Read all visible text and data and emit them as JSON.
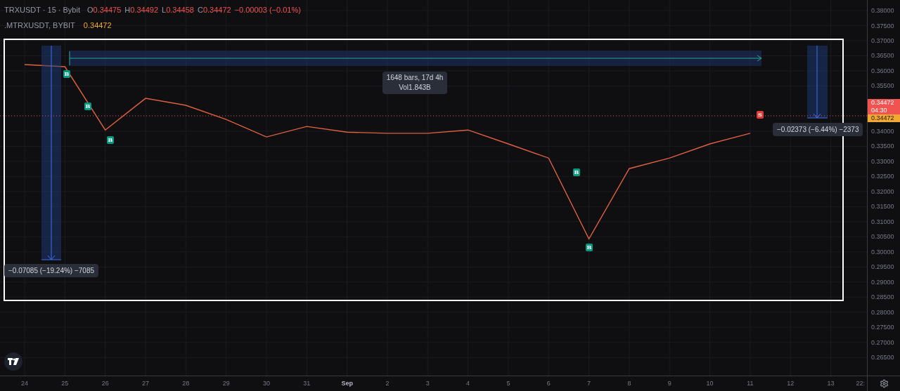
{
  "legend": {
    "symbol": "TRXUSDT · 15 · Bybit",
    "ohlc": [
      {
        "label": "O",
        "value": "0.34475"
      },
      {
        "label": "H",
        "value": "0.34492"
      },
      {
        "label": "L",
        "value": "0.34458"
      },
      {
        "label": "C",
        "value": "0.34472"
      }
    ],
    "change": "−0.00003 (−0.01%)"
  },
  "indicator": {
    "name": ".MTRXUSDT, BYBIT",
    "value": "0.34472"
  },
  "chart": {
    "chart_data": {
      "type": "line",
      "categories": [
        "24",
        "25",
        "26",
        "27",
        "28",
        "29",
        "30",
        "31",
        "Sep",
        "2",
        "3",
        "4",
        "5",
        "6",
        "7",
        "8",
        "9",
        "10",
        "11",
        "12",
        "13"
      ],
      "ylim": [
        0.259,
        0.3835
      ],
      "grid": true,
      "series": [
        {
          "color": "#e0613f",
          "values": [
            0.3621,
            0.3614,
            0.3404,
            0.3509,
            0.3486,
            0.3439,
            0.3381,
            0.3416,
            0.3397,
            0.3393,
            0.3393,
            0.3404,
            0.3358,
            0.3311,
            0.3043,
            0.3276,
            0.3311,
            0.3358,
            0.3393,
            null,
            null
          ]
        }
      ],
      "yticks": [
        {
          "value": 0.38,
          "label": "0.38000"
        },
        {
          "value": 0.375,
          "label": "0.37500"
        },
        {
          "value": 0.37,
          "label": "0.37000"
        },
        {
          "value": 0.365,
          "label": "0.36500"
        },
        {
          "value": 0.36,
          "label": "0.36000"
        },
        {
          "value": 0.355,
          "label": "0.35500"
        },
        {
          "value": 0.34,
          "label": "0.34000"
        },
        {
          "value": 0.335,
          "label": "0.33500"
        },
        {
          "value": 0.33,
          "label": "0.33000"
        },
        {
          "value": 0.325,
          "label": "0.32500"
        },
        {
          "value": 0.32,
          "label": "0.32000"
        },
        {
          "value": 0.315,
          "label": "0.31500"
        },
        {
          "value": 0.31,
          "label": "0.31000"
        },
        {
          "value": 0.305,
          "label": "0.30500"
        },
        {
          "value": 0.3,
          "label": "0.30000"
        },
        {
          "value": 0.295,
          "label": "0.29500"
        },
        {
          "value": 0.29,
          "label": "0.29000"
        },
        {
          "value": 0.285,
          "label": "0.28500"
        },
        {
          "value": 0.28,
          "label": "0.28000"
        },
        {
          "value": 0.275,
          "label": "0.27500"
        },
        {
          "value": 0.27,
          "label": "0.27000"
        },
        {
          "value": 0.265,
          "label": "0.26500"
        }
      ]
    },
    "time_axis_tail": "22:",
    "markers": [
      {
        "kind": "buy",
        "label": "B"
      },
      {
        "kind": "buy",
        "label": "B"
      },
      {
        "kind": "buy",
        "label": "B"
      },
      {
        "kind": "buy",
        "label": "B"
      },
      {
        "kind": "buy",
        "label": "B"
      },
      {
        "kind": "sell",
        "label": "S"
      }
    ],
    "range_info": {
      "bars": "1648 bars, 17d 4h",
      "volume": "Vol1.843B"
    },
    "measurements": [
      "−0.07085 (−19.24%) −7085",
      "−0.02373 (−6.44%) −2373"
    ],
    "last_price": {
      "price": "0.34472",
      "countdown": "04:30",
      "indicator_price": "0.34472"
    }
  }
}
